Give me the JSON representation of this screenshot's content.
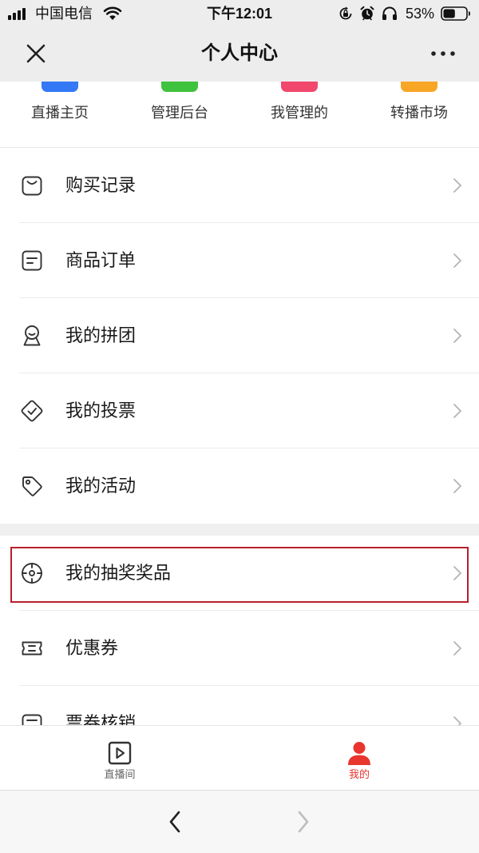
{
  "status_bar": {
    "carrier": "中国电信",
    "time": "下午12:01",
    "battery": "53%",
    "left_icons": [
      "signal-icon",
      "wifi-icon"
    ],
    "right_icons": [
      "rotation-lock-icon",
      "alarm-icon",
      "headphones-icon",
      "battery-icon"
    ]
  },
  "nav": {
    "title": "个人中心",
    "left_icon": "close-icon",
    "right_icon": "more-icon"
  },
  "quick_items": [
    {
      "label": "直播主页",
      "color": "#3478f6"
    },
    {
      "label": "管理后台",
      "color": "#3fc23d"
    },
    {
      "label": "我管理的",
      "color": "#f2476c"
    },
    {
      "label": "转播市场",
      "color": "#f8a626"
    }
  ],
  "menu": {
    "group1": [
      {
        "label": "购买记录",
        "icon": "shopping-bag-icon"
      },
      {
        "label": "商品订单",
        "icon": "order-document-icon"
      },
      {
        "label": "我的拼团",
        "icon": "group-buy-icon"
      },
      {
        "label": "我的投票",
        "icon": "vote-icon"
      },
      {
        "label": "我的活动",
        "icon": "activity-tag-icon"
      }
    ],
    "group2": [
      {
        "label": "我的抽奖奖品",
        "icon": "lottery-target-icon",
        "highlighted": true
      },
      {
        "label": "优惠券",
        "icon": "coupon-icon"
      },
      {
        "label": "票券核销",
        "icon": "ticket-verify-icon"
      }
    ],
    "chevron_icon": "chevron-right-icon"
  },
  "tab_bar": {
    "items": [
      {
        "label": "直播间",
        "icon": "live-play-icon",
        "active": false
      },
      {
        "label": "我的",
        "icon": "user-icon",
        "active": true
      }
    ]
  },
  "browser_bar": {
    "back_icon": "back-arrow-icon",
    "forward_icon": "forward-arrow-icon"
  },
  "colors": {
    "header_bg": "#ededed",
    "accent": "#e8352e",
    "highlight_border": "#b81f2b",
    "muted": "#666666",
    "chevron": "#b3b3b3"
  }
}
